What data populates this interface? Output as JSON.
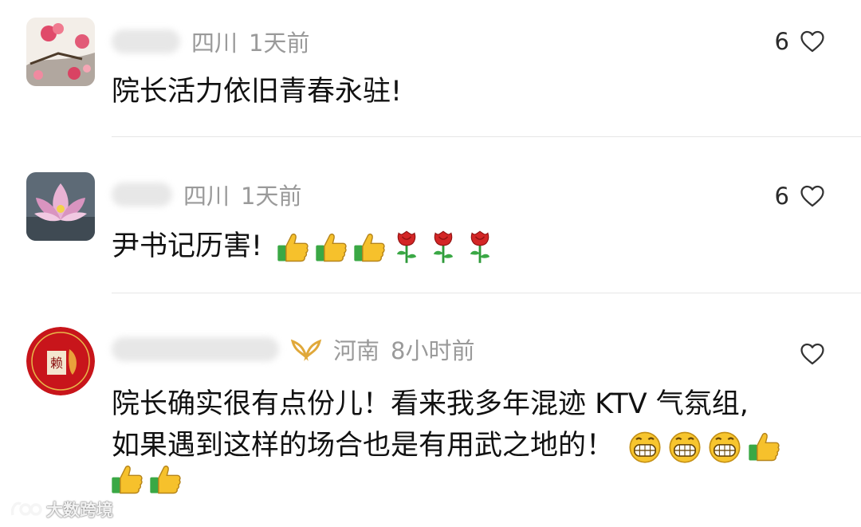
{
  "comments": [
    {
      "region": "四川",
      "time": "1天前",
      "likes": "6",
      "text": "院长活力依旧青春永驻!",
      "avatar": "peach-blossom-painting"
    },
    {
      "region": "四川",
      "time": "1天前",
      "likes": "6",
      "text": "尹书记历害!",
      "emojis": [
        "thumbs-up",
        "thumbs-up",
        "thumbs-up",
        "rose",
        "rose",
        "rose"
      ],
      "avatar": "lotus-flower"
    },
    {
      "region": "河南",
      "time": "8小时前",
      "likes": "",
      "badge": "gold-wing-badge",
      "text_line1": "院长确实很有点份儿！看来我多年混迹 KTV 气氛组,",
      "text_line2": "如果遇到这样的场合也是有用武之地的！",
      "emojis_line2": [
        "grin",
        "grin",
        "grin",
        "thumbs-up"
      ],
      "emojis_line3": [
        "thumbs-up",
        "thumbs-up"
      ],
      "avatar": "red-seal-circle"
    }
  ],
  "watermark": {
    "text": "大数跨境",
    "logo": "watermark-logo"
  },
  "colors": {
    "meta": "#9a9a9a",
    "text": "#111111",
    "divider": "#e6e6e6"
  }
}
